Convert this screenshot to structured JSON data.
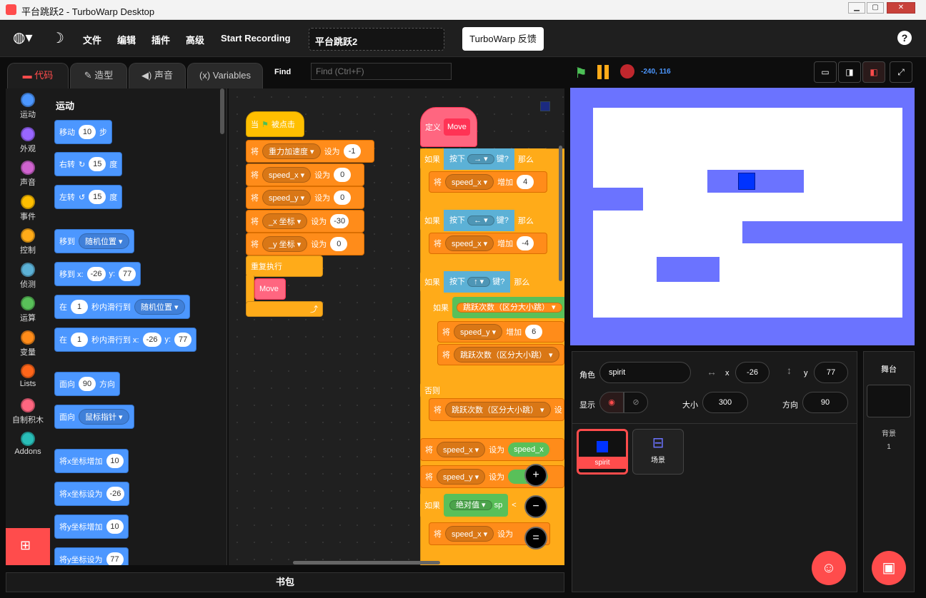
{
  "window": {
    "title": "平台跳跃2 - TurboWarp Desktop"
  },
  "menu": {
    "file": "文件",
    "edit": "编辑",
    "addons": "插件",
    "advanced": "高级",
    "record": "Start Recording",
    "project_title": "平台跳跃2",
    "feedback": "TurboWarp 反馈"
  },
  "tabs": {
    "code": "代码",
    "costumes": "造型",
    "sounds": "声音",
    "variables": "Variables"
  },
  "find": {
    "label": "Find",
    "placeholder": "Find (Ctrl+F)"
  },
  "categories": [
    {
      "label": "运动",
      "color": "#4c97ff"
    },
    {
      "label": "外观",
      "color": "#9966ff"
    },
    {
      "label": "声音",
      "color": "#cf63cf"
    },
    {
      "label": "事件",
      "color": "#ffbf00"
    },
    {
      "label": "控制",
      "color": "#ffab19"
    },
    {
      "label": "侦测",
      "color": "#5cb1d6"
    },
    {
      "label": "运算",
      "color": "#59c059"
    },
    {
      "label": "变量",
      "color": "#ff8c1a"
    },
    {
      "label": "Lists",
      "color": "#ff661a"
    },
    {
      "label": "自制积木",
      "color": "#ff6680"
    },
    {
      "label": "Addons",
      "color": "#29beb8"
    }
  ],
  "palette": {
    "title": "运动",
    "move": {
      "a": "移动",
      "n": "10",
      "b": "步"
    },
    "turn_right": {
      "a": "右转",
      "n": "15",
      "b": "度"
    },
    "turn_left": {
      "a": "左转",
      "n": "15",
      "b": "度"
    },
    "goto": {
      "a": "移到",
      "dd": "随机位置"
    },
    "goto_xy": {
      "a": "移到 x:",
      "x": "-26",
      "b": "y:",
      "y": "77"
    },
    "glide": {
      "a": "在",
      "n": "1",
      "b": "秒内滑行到",
      "dd": "随机位置"
    },
    "glide_xy": {
      "a": "在",
      "n": "1",
      "b": "秒内滑行到 x:",
      "x": "-26",
      "c": "y:",
      "y": "77"
    },
    "point_dir": {
      "a": "面向",
      "n": "90",
      "b": "方向"
    },
    "point_to": {
      "a": "面向",
      "dd": "鼠标指针"
    },
    "change_x": {
      "a": "将x坐标增加",
      "n": "10"
    },
    "set_x": {
      "a": "将x坐标设为",
      "n": "-26"
    },
    "change_y": {
      "a": "将y坐标增加",
      "n": "10"
    },
    "set_y": {
      "a": "将y坐标设为",
      "n": "77"
    }
  },
  "script1": {
    "hat": {
      "a": "当",
      "b": "被点击"
    },
    "rows": [
      {
        "a": "将",
        "dd": "重力加速度",
        "b": "设为",
        "v": "-1"
      },
      {
        "a": "将",
        "dd": "speed_x",
        "b": "设为",
        "v": "0"
      },
      {
        "a": "将",
        "dd": "speed_y",
        "b": "设为",
        "v": "0"
      },
      {
        "a": "将",
        "dd": "_x 坐标",
        "b": "设为",
        "v": "-30"
      },
      {
        "a": "将",
        "dd": "_y 坐标",
        "b": "设为",
        "v": "0"
      }
    ],
    "forever": "重复执行",
    "call": "Move"
  },
  "script2": {
    "define": "定义",
    "name": "Move",
    "if1": {
      "a": "如果",
      "key_a": "按下",
      "key": "→",
      "key_b": "键?",
      "then": "那么",
      "set": "将",
      "var": "speed_x",
      "op": "增加",
      "v": "4"
    },
    "if2": {
      "a": "如果",
      "key_a": "按下",
      "key": "←",
      "key_b": "键?",
      "then": "那么",
      "set": "将",
      "var": "speed_x",
      "op": "增加",
      "v": "-4"
    },
    "if3": {
      "a": "如果",
      "key_a": "按下",
      "key": "↑",
      "key_b": "键?",
      "then": "那么"
    },
    "inner_if": {
      "a": "如果",
      "cond": "跳跃次数（区分大小跳）"
    },
    "row_speed_y": {
      "a": "将",
      "var": "speed_y",
      "op": "增加",
      "v": "6"
    },
    "row_jump": {
      "a": "将",
      "var": "跳跃次数（区分大小跳）"
    },
    "else": "否则",
    "row_else": {
      "a": "将",
      "var": "跳跃次数（区分大小跳）",
      "tail": "设"
    },
    "row_sx": {
      "a": "将",
      "var": "speed_x",
      "op": "设为",
      "v": "speed_x"
    },
    "row_sy": {
      "a": "将",
      "var": "speed_y",
      "op": "设为",
      "v": "y"
    },
    "if4": {
      "a": "如果",
      "fn": "绝对值",
      "v": "sp",
      "lt": "<"
    },
    "row_last": {
      "a": "将",
      "var": "speed_x",
      "op": "设为"
    }
  },
  "zoom": {
    "in": "+",
    "out": "−",
    "reset": "="
  },
  "backpack": "书包",
  "stage_header": {
    "coords": "-240, 116"
  },
  "sprite_info": {
    "sprite_label": "角色",
    "sprite_name": "spirit",
    "x_label": "x",
    "x": "-26",
    "y_label": "y",
    "y": "77",
    "show_label": "显示",
    "size_label": "大小",
    "size": "300",
    "dir_label": "方向",
    "dir": "90"
  },
  "sprites": [
    {
      "name": "spirit"
    },
    {
      "name": "场景"
    }
  ],
  "stage_panel": {
    "title": "舞台",
    "backdrops_label": "背景",
    "backdrops_count": "1"
  },
  "colors": {
    "accent": "#ff4c4c",
    "motion": "#4c97ff",
    "control": "#ffab19",
    "variables": "#ff8c1a",
    "custom": "#ff6680",
    "stage_blue": "#6b73ff",
    "player": "#0033ff"
  }
}
